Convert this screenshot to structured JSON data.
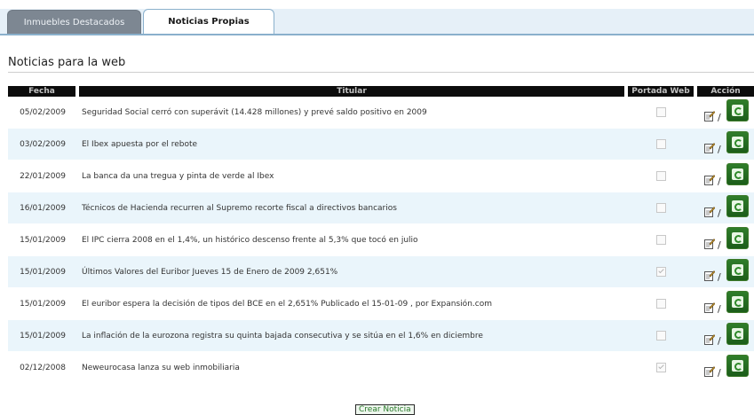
{
  "tabs": [
    {
      "label": "Inmuebles Destacados",
      "active": false
    },
    {
      "label": "Noticias Propias",
      "active": true
    }
  ],
  "section_title": "Noticias para la web",
  "table": {
    "headers": {
      "fecha": "Fecha",
      "titular": "Titular",
      "portada": "Portada Web",
      "accion": "Acción"
    },
    "action_separator": "/",
    "rows": [
      {
        "fecha": "05/02/2009",
        "titular": "Seguridad Social cerró con superávit (14.428 millones) y prevé saldo positivo en 2009",
        "portada": false
      },
      {
        "fecha": "03/02/2009",
        "titular": "El Ibex apuesta por el rebote",
        "portada": false
      },
      {
        "fecha": "22/01/2009",
        "titular": "La banca da una tregua y pinta de verde al Ibex",
        "portada": false
      },
      {
        "fecha": "16/01/2009",
        "titular": "Técnicos de Hacienda recurren al Supremo recorte fiscal a directivos bancarios",
        "portada": false
      },
      {
        "fecha": "15/01/2009",
        "titular": "El IPC cierra 2008 en el 1,4%, un histórico descenso frente al 5,3% que tocó en julio",
        "portada": false
      },
      {
        "fecha": "15/01/2009",
        "titular": "Últimos Valores del Euribor Jueves 15 de Enero de 2009 2,651%",
        "portada": true
      },
      {
        "fecha": "15/01/2009",
        "titular": "El euribor espera la decisión de tipos del BCE en el 2,651% Publicado el 15-01-09 , por Expansión.com",
        "portada": false
      },
      {
        "fecha": "15/01/2009",
        "titular": "La inflación de la eurozona registra su quinta bajada consecutiva y se sitúa en el 1,6% en diciembre",
        "portada": false
      },
      {
        "fecha": "02/12/2008",
        "titular": "Neweurocasa lanza su web inmobiliaria",
        "portada": true
      }
    ]
  },
  "create_button_label": "Crear Noticia",
  "colors": {
    "header_bg": "#0c0c0c",
    "row_alt_bg": "#eaf5fb",
    "tab_strip": "#e6f0f8",
    "delete_icon": "#2f7d2a"
  }
}
